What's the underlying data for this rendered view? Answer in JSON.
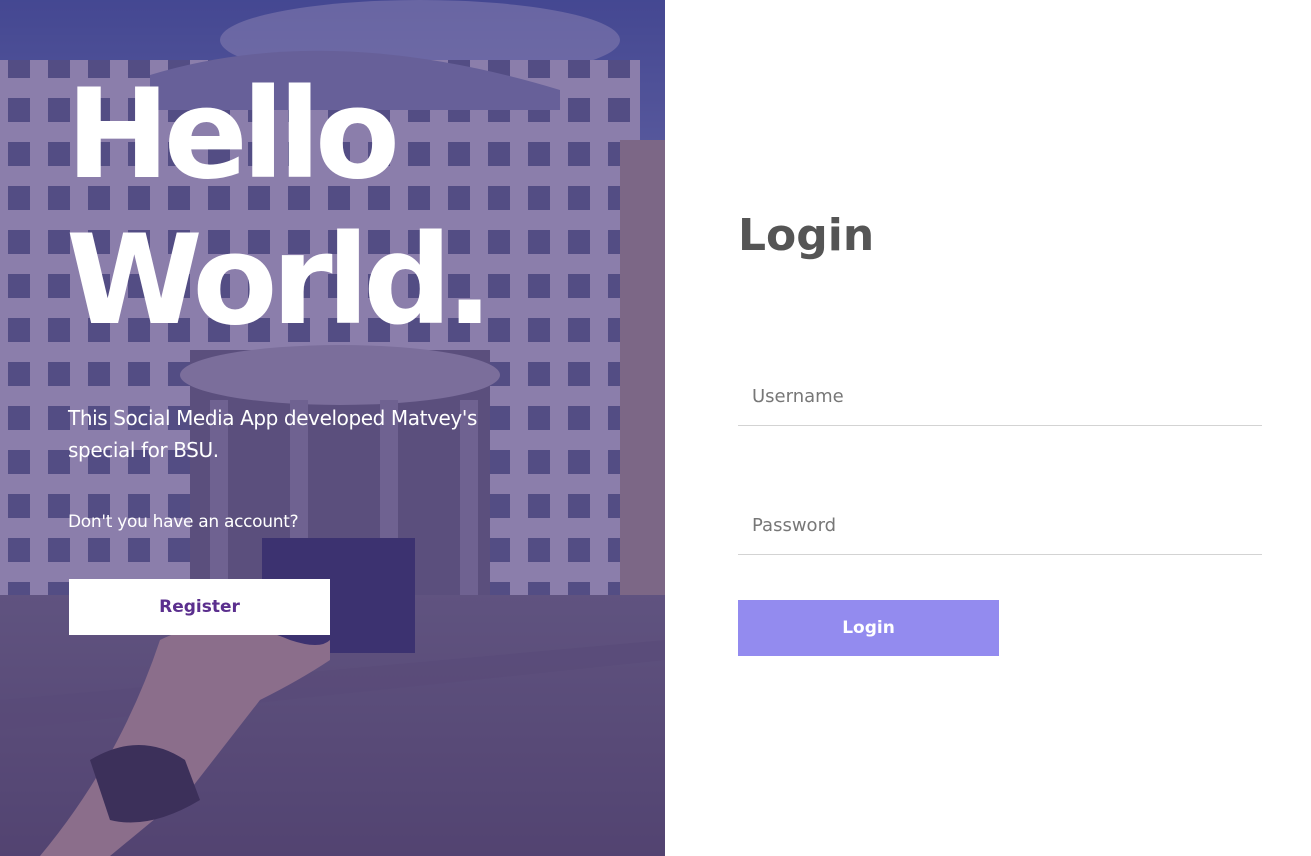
{
  "hero": {
    "title_line1": "Hello",
    "title_line2": "World.",
    "description": "This Social Media App developed Matvey's special for BSU.",
    "question": "Don't you have an account?",
    "register_label": "Register",
    "overlay_color": "#4a3480",
    "image": "building-photo"
  },
  "login": {
    "title": "Login",
    "username_placeholder": "Username",
    "username_value": "",
    "password_placeholder": "Password",
    "password_value": "",
    "login_label": "Login",
    "button_color": "#938bef",
    "title_color": "#555555"
  }
}
